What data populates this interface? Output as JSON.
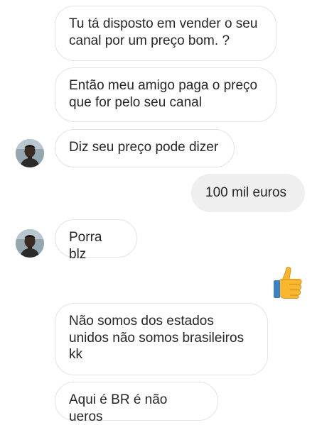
{
  "messages": [
    {
      "id": "m1",
      "direction": "received",
      "text": "Tu tá disposto em vender o seu canal por um preço bom. ?",
      "avatar": false
    },
    {
      "id": "m2",
      "direction": "received",
      "text": "Então meu amigo paga o preço que for pelo seu canal",
      "avatar": false
    },
    {
      "id": "m3",
      "direction": "received",
      "text": "Diz seu preço pode dizer",
      "avatar": true
    },
    {
      "id": "m4",
      "direction": "sent",
      "text": "100 mil euros"
    },
    {
      "id": "m5",
      "direction": "received",
      "text": "Porra blz",
      "avatar": true
    },
    {
      "id": "m6",
      "direction": "sent",
      "emoji": "thumbs-up-icon"
    },
    {
      "id": "m7",
      "direction": "received",
      "text": "Não somos dos estados unidos não somos brasileiros kk",
      "avatar": false
    },
    {
      "id": "m8",
      "direction": "received",
      "text": "Aqui é BR é não ueros",
      "avatar": false
    }
  ],
  "colors": {
    "received_border": "#e3e3e3",
    "sent_background": "#efefef",
    "text": "#262626",
    "thumb": "#f7b72e"
  }
}
